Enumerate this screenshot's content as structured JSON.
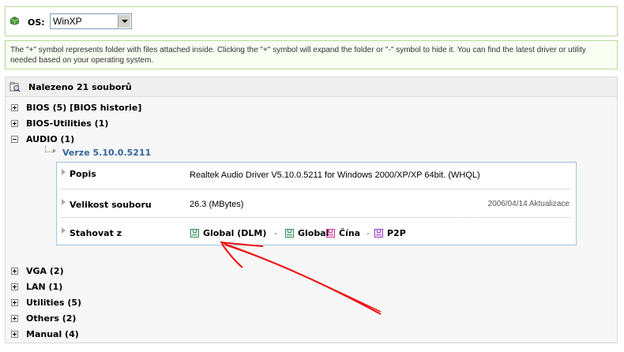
{
  "os_selector": {
    "label": "OS:",
    "value": "WinXP"
  },
  "info_text": "The \"+\" symbol represents folder with files attached inside. Clicking the \"+\" symbol will expand the folder or \"-\" symbol to hide it. You can find the latest driver or utility needed based on your operating system.",
  "results": {
    "title": "Nalezeno 21 souborů",
    "categories_top": [
      {
        "label": "BIOS  (5)  [BIOS historie]",
        "state": "collapsed"
      },
      {
        "label": "BIOS-Utilities  (1)",
        "state": "collapsed"
      },
      {
        "label": "AUDIO  (1)",
        "state": "expanded"
      }
    ],
    "version": "Verze 5.10.0.5211",
    "details": {
      "description_label": "Popis",
      "description_value": "Realtek Audio Driver V5.10.0.5211 for Windows 2000/XP/XP 64bit. (WHQL)",
      "size_label": "Velikost souboru",
      "size_value": "26.3 (MBytes)",
      "date": "2006/04/14 Aktualizace",
      "download_label": "Stahovat z",
      "downloads": [
        {
          "label": "Global (DLM)",
          "color": "#2e8b57"
        },
        {
          "label": "Global",
          "color": "#2e8b57"
        },
        {
          "label": "Čína",
          "color": "#cc3399"
        },
        {
          "label": "P2P",
          "color": "#9933cc"
        }
      ],
      "separator": "-"
    },
    "categories_bottom": [
      {
        "label": "VGA  (2)",
        "state": "collapsed"
      },
      {
        "label": "LAN  (1)",
        "state": "collapsed"
      },
      {
        "label": "Utilities  (5)",
        "state": "collapsed"
      },
      {
        "label": "Others  (2)",
        "state": "collapsed"
      },
      {
        "label": "Manual  (4)",
        "state": "collapsed"
      }
    ]
  },
  "annotation": {
    "color": "#ee1111"
  }
}
